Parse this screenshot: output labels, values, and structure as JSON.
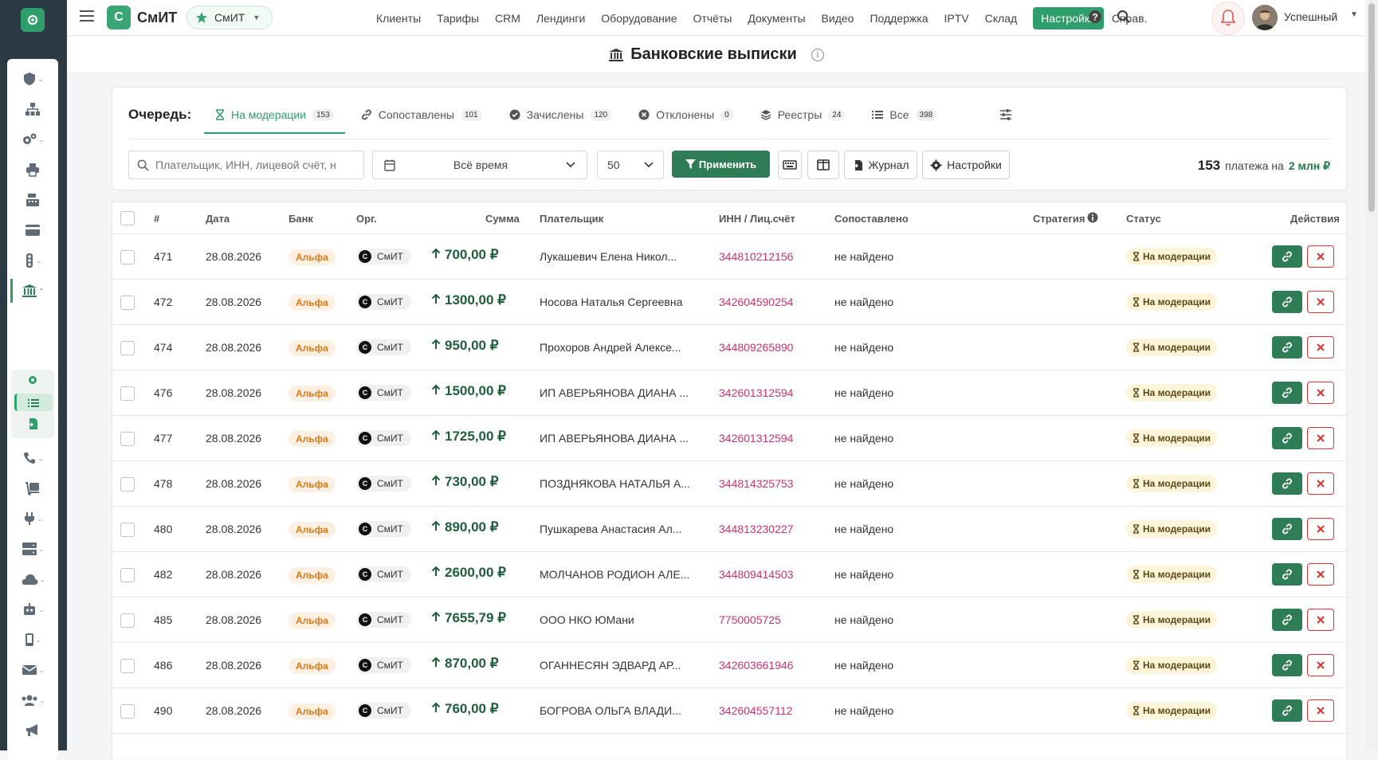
{
  "app": {
    "brand": "СмИТ",
    "brand_icon_letter": "С",
    "org_pill": "СмИТ",
    "user_name": "Успешный"
  },
  "nav": [
    "Клиенты",
    "Тарифы",
    "CRM",
    "Лендинги",
    "Оборудование",
    "Отчёты",
    "Документы",
    "Видео",
    "Поддержка",
    "IPTV",
    "Склад",
    "Настройки",
    "Справ."
  ],
  "nav_active": "Настройки",
  "page": {
    "title": "Банковские выписки",
    "info": "i"
  },
  "queue": {
    "label": "Очередь:",
    "tabs": [
      {
        "label": "На модерации",
        "count": "153",
        "icon": "hourglass-icon"
      },
      {
        "label": "Сопоставлены",
        "count": "101",
        "icon": "link-icon"
      },
      {
        "label": "Зачислены",
        "count": "120",
        "icon": "check-circle-icon"
      },
      {
        "label": "Отклонены",
        "count": "0",
        "icon": "x-circle-icon"
      },
      {
        "label": "Реестры",
        "count": "24",
        "icon": "layers-icon"
      },
      {
        "label": "Все",
        "count": "398",
        "icon": "list-icon"
      }
    ]
  },
  "filters": {
    "search_placeholder": "Плательщик, ИНН, лицевой счёт, н",
    "date_value": "Всё время",
    "page_size": "50",
    "apply_label": "Применить",
    "journal_label": "Журнал",
    "settings_label": "Настройки"
  },
  "summary": {
    "count": "153",
    "text": "платежа на",
    "amount": "2 млн ₽"
  },
  "table": {
    "headers": {
      "num": "#",
      "date": "Дата",
      "bank": "Банк",
      "org": "Орг.",
      "sum": "Сумма",
      "payer": "Плательщик",
      "inn": "ИНН / Лиц.счёт",
      "matched": "Сопоставлено",
      "strategy": "Стратегия",
      "status": "Статус",
      "actions": "Действия"
    },
    "rows": [
      {
        "id": "471",
        "date": "28.08.2026",
        "bank": "Альфа",
        "org": "СмИТ",
        "sum": "700,00 ₽",
        "payer": "Лукашевич Елена Никол...",
        "inn": "344810212156",
        "matched": "не найдено",
        "status": "На модерации"
      },
      {
        "id": "472",
        "date": "28.08.2026",
        "bank": "Альфа",
        "org": "СмИТ",
        "sum": "1300,00 ₽",
        "payer": "Носова Наталья Сергеевна",
        "inn": "342604590254",
        "matched": "не найдено",
        "status": "На модерации"
      },
      {
        "id": "474",
        "date": "28.08.2026",
        "bank": "Альфа",
        "org": "СмИТ",
        "sum": "950,00 ₽",
        "payer": "Прохоров Андрей Алексе...",
        "inn": "344809265890",
        "matched": "не найдено",
        "status": "На модерации"
      },
      {
        "id": "476",
        "date": "28.08.2026",
        "bank": "Альфа",
        "org": "СмИТ",
        "sum": "1500,00 ₽",
        "payer": "ИП АВЕРЬЯНОВА ДИАНА ...",
        "inn": "342601312594",
        "matched": "не найдено",
        "status": "На модерации"
      },
      {
        "id": "477",
        "date": "28.08.2026",
        "bank": "Альфа",
        "org": "СмИТ",
        "sum": "1725,00 ₽",
        "payer": "ИП АВЕРЬЯНОВА ДИАНА ...",
        "inn": "342601312594",
        "matched": "не найдено",
        "status": "На модерации"
      },
      {
        "id": "478",
        "date": "28.08.2026",
        "bank": "Альфа",
        "org": "СмИТ",
        "sum": "730,00 ₽",
        "payer": "ПОЗДНЯКОВА НАТАЛЬЯ А...",
        "inn": "344814325753",
        "matched": "не найдено",
        "status": "На модерации"
      },
      {
        "id": "480",
        "date": "28.08.2026",
        "bank": "Альфа",
        "org": "СмИТ",
        "sum": "890,00 ₽",
        "payer": "Пушкарева Анастасия Ал...",
        "inn": "344813230227",
        "matched": "не найдено",
        "status": "На модерации"
      },
      {
        "id": "482",
        "date": "28.08.2026",
        "bank": "Альфа",
        "org": "СмИТ",
        "sum": "2600,00 ₽",
        "payer": "МОЛЧАНОВ РОДИОН АЛЕ...",
        "inn": "344809414503",
        "matched": "не найдено",
        "status": "На модерации"
      },
      {
        "id": "485",
        "date": "28.08.2026",
        "bank": "Альфа",
        "org": "СмИТ",
        "sum": "7655,79 ₽",
        "payer": "ООО НКО ЮМани",
        "inn": "7750005725",
        "matched": "не найдено",
        "status": "На модерации"
      },
      {
        "id": "486",
        "date": "28.08.2026",
        "bank": "Альфа",
        "org": "СмИТ",
        "sum": "870,00 ₽",
        "payer": "ОГАННЕСЯН ЭДВАРД АР...",
        "inn": "342603661946",
        "matched": "не найдено",
        "status": "На модерации"
      },
      {
        "id": "490",
        "date": "28.08.2026",
        "bank": "Альфа",
        "org": "СмИТ",
        "sum": "760,00 ₽",
        "payer": "БОГРОВА ОЛЬГА ВЛАДИ...",
        "inn": "342604557112",
        "matched": "не найдено",
        "status": "На модерации"
      }
    ]
  },
  "colors": {
    "accent": "#2e9e6b",
    "apply": "#2e7d57",
    "inn": "#d0326f",
    "reject": "#dd3333",
    "status_bg": "#fdf4d9",
    "bank_badge": "#e07a16"
  }
}
